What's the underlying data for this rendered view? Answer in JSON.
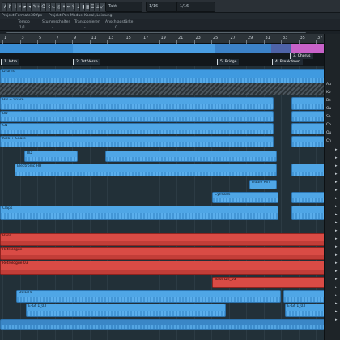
{
  "toolbar": {
    "buttons": [
      "A",
      "N",
      "I",
      "M",
      "▸",
      "◂",
      "✎",
      "✂",
      "⌫",
      "⟲",
      "▭",
      "◎",
      "✦",
      "↔",
      "⚲",
      "♪",
      "▮",
      "▦",
      "☰",
      "⟂",
      "⤢"
    ],
    "snap_label": "Takt",
    "quantize_label": "1/16",
    "mode_label": "1/16"
  },
  "infoline": {
    "project": "Projekt-Formate",
    "fps": "30 fps",
    "music": "Projekt-Pan-Modus",
    "link": "Kanal, Leistung"
  },
  "header_row": {
    "c1": "Tempo",
    "c2": "Stummschalten",
    "c3": "Transponieren",
    "c4": "Anschlagstärke",
    "v1": "1/1",
    "v2": "-",
    "v3": "-",
    "v4": "0"
  },
  "ruler": {
    "ticks": [
      "1",
      "3",
      "5",
      "7",
      "9",
      "11",
      "13",
      "15",
      "17",
      "19",
      "21",
      "23",
      "25",
      "27",
      "29",
      "31",
      "33",
      "35",
      "37"
    ]
  },
  "markers": [
    {
      "label": "1. Intro"
    },
    {
      "label": "2. 1st Verse"
    },
    {
      "label": "5. Bridge"
    },
    {
      "label": "4. Breakdown"
    },
    {
      "label": "3. Chorus"
    }
  ],
  "tracks": {
    "labels": {
      "drums": "Drums",
      "hh": "HH + Snare",
      "bd": "BD",
      "sn": "SN",
      "kick": "Kick + Snare",
      "bd2": "BD",
      "electro": "Electronic HH",
      "fx": "Fiddle Riff",
      "cymbals": "Cymbals",
      "claps": "Claps",
      "bass": "Bass",
      "retro1": "Retrologue",
      "retro2": "Retrologue 03",
      "bass_d": "Bass Dri_03",
      "guitars": "Guitars",
      "gt2": "E-Gt 1_03",
      "gt3": "E-Gt 1_03"
    }
  },
  "right_panel": {
    "items": [
      "Au",
      "Ko",
      "Be",
      "Ou",
      "Sa",
      "Co",
      "Qu",
      "Ch"
    ]
  },
  "colors": {
    "accent_blue": "#4fa6e6",
    "accent_red": "#d94b45",
    "arranger_blue": "#3b8fd6",
    "arranger_purple": "#c862c9"
  }
}
